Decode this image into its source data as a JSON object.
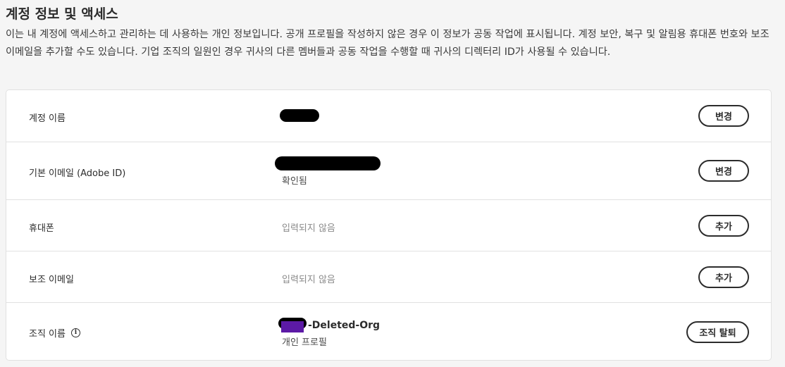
{
  "page": {
    "title": "계정 정보 및 액세스",
    "description": "이는 내 계정에 액세스하고 관리하는 데 사용하는 개인 정보입니다. 공개 프로필을 작성하지 않은 경우 이 정보가 공동 작업에 표시됩니다. 계정 보안, 복구 및 알림용 휴대폰 번호와 보조 이메일을 추가할 수도 있습니다. 기업 조직의 일원인 경우 귀사의 다른 멤버들과 공동 작업을 수행할 때 귀사의 디렉터리 ID가 사용될 수 있습니다."
  },
  "rows": {
    "account_name": {
      "label": "계정 이름",
      "button": "변경"
    },
    "primary_email": {
      "label": "기본 이메일 (Adobe ID)",
      "status": "확인됨",
      "button": "변경"
    },
    "phone": {
      "label": "휴대폰",
      "value": "입력되지 않음",
      "button": "추가"
    },
    "secondary_email": {
      "label": "보조 이메일",
      "value": "입력되지 않음",
      "button": "추가"
    },
    "organization": {
      "label": "조직 이름",
      "info_icon": "info-icon",
      "name": "-Deleted-Org",
      "sub": "개인 프로필",
      "button": "조직 탈퇴"
    }
  },
  "colors": {
    "org_logo": "#5c1aa6",
    "redaction": "#000000"
  }
}
